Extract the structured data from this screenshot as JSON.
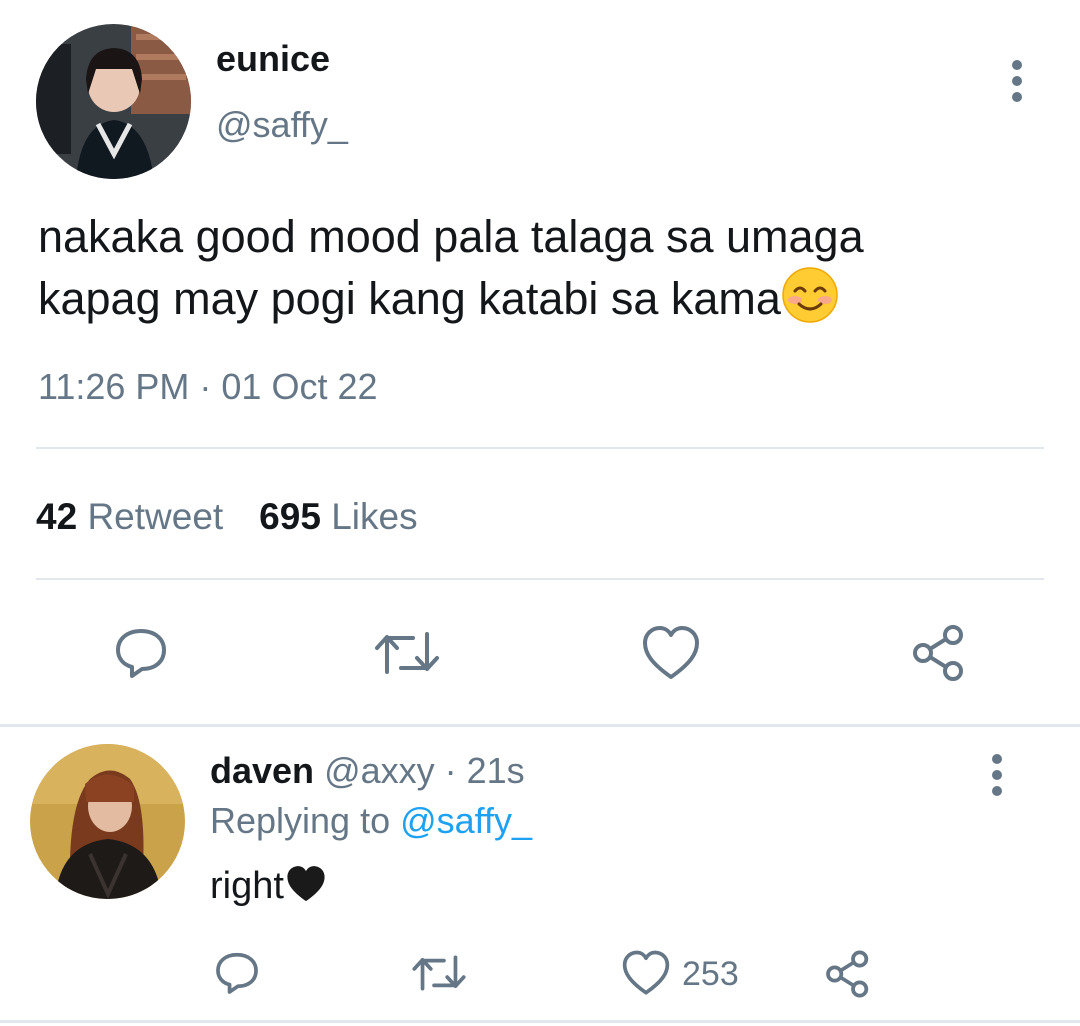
{
  "main_tweet": {
    "name": "eunice",
    "handle": "@saffy_",
    "text_line1": "nakaka good mood pala talaga sa umaga",
    "text_line2": "kapag may pogi kang katabi sa kama",
    "emoji": "smiling-face-with-smiling-eyes",
    "timestamp": "11:26 PM · 01 Oct 22",
    "retweet_count": "42",
    "retweet_label": "Retweet",
    "likes_count": "695",
    "likes_label": "Likes"
  },
  "reply": {
    "name": "daven",
    "handle": "@axxy",
    "separator": " · ",
    "age": "21s",
    "replying_prefix": "Replying to ",
    "replying_to": "@saffy_",
    "text": "right",
    "emoji": "black-heart",
    "like_count": "253"
  },
  "colors": {
    "text": "#14171a",
    "secondary": "#657786",
    "link": "#1da1f2",
    "divider": "#e1e8ed"
  }
}
